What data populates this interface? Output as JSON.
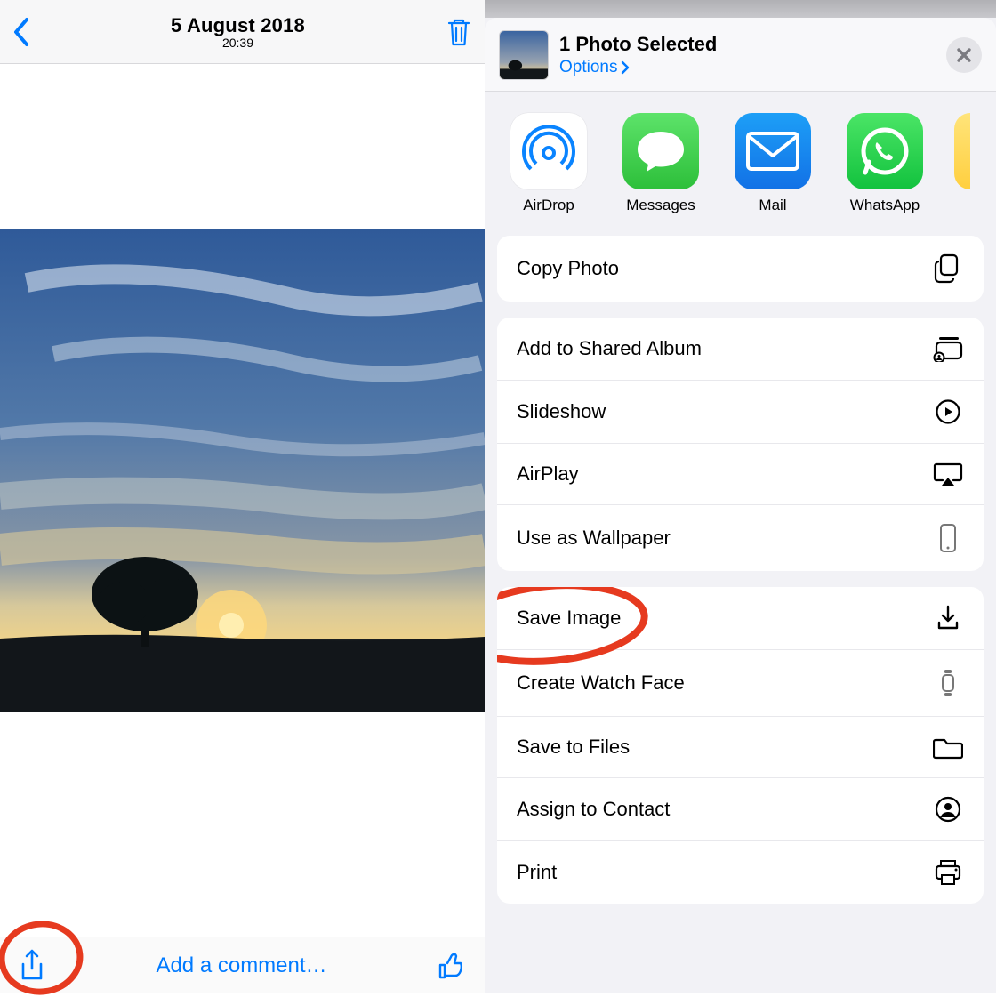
{
  "left": {
    "date": "5 August 2018",
    "time": "20:39",
    "comment_link": "Add a comment…"
  },
  "sheet": {
    "title": "1 Photo Selected",
    "options_label": "Options",
    "apps": [
      {
        "label": "AirDrop"
      },
      {
        "label": "Messages"
      },
      {
        "label": "Mail"
      },
      {
        "label": "WhatsApp"
      }
    ],
    "group1": [
      {
        "label": "Copy Photo",
        "icon": "copy-icon"
      }
    ],
    "group2": [
      {
        "label": "Add to Shared Album",
        "icon": "shared-album-icon"
      },
      {
        "label": "Slideshow",
        "icon": "play-circle-icon"
      },
      {
        "label": "AirPlay",
        "icon": "airplay-icon"
      },
      {
        "label": "Use as Wallpaper",
        "icon": "phone-icon"
      }
    ],
    "group3": [
      {
        "label": "Save Image",
        "icon": "download-icon",
        "annotated": true
      },
      {
        "label": "Create Watch Face",
        "icon": "watch-icon"
      },
      {
        "label": "Save to Files",
        "icon": "folder-icon"
      },
      {
        "label": "Assign to Contact",
        "icon": "contact-icon"
      },
      {
        "label": "Print",
        "icon": "printer-icon"
      }
    ]
  }
}
